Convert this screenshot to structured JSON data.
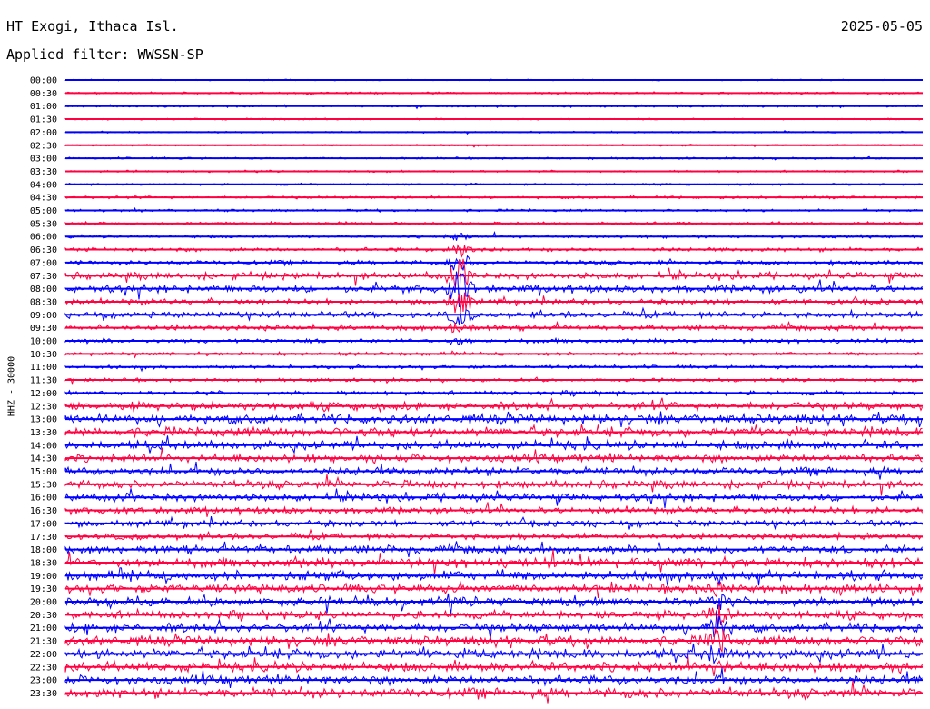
{
  "header": {
    "station": "HT Exogi, Ithaca Isl.",
    "date": "2025-05-05",
    "filter": "Applied filter: WWSSN-SP"
  },
  "colors": {
    "even_hour": "#0000ff",
    "odd_hour": "#ff0040",
    "background": "#ffffff"
  },
  "chart_data": {
    "type": "line",
    "title": "HT Exogi, Ithaca Isl.",
    "ylabel": "HHZ - 30000",
    "row_labels": [
      "00:00",
      "00:30",
      "01:00",
      "01:30",
      "02:00",
      "02:30",
      "03:00",
      "03:30",
      "04:00",
      "04:30",
      "05:00",
      "05:30",
      "06:00",
      "06:30",
      "07:00",
      "07:30",
      "08:00",
      "08:30",
      "09:00",
      "09:30",
      "10:00",
      "10:30",
      "11:00",
      "11:30",
      "12:00",
      "12:30",
      "13:00",
      "13:30",
      "14:00",
      "14:30",
      "15:00",
      "15:30",
      "16:00",
      "16:30",
      "17:00",
      "17:30",
      "18:00",
      "18:30",
      "19:00",
      "19:30",
      "20:00",
      "20:30",
      "21:00",
      "21:30",
      "22:00",
      "22:30",
      "23:00",
      "23:30"
    ],
    "row_colors": [
      "blue",
      "red",
      "blue",
      "red",
      "blue",
      "red",
      "blue",
      "red",
      "blue",
      "red",
      "blue",
      "red",
      "blue",
      "red",
      "blue",
      "red",
      "blue",
      "red",
      "blue",
      "red",
      "blue",
      "red",
      "blue",
      "red",
      "blue",
      "red",
      "blue",
      "red",
      "blue",
      "red",
      "blue",
      "red",
      "blue",
      "red",
      "blue",
      "red",
      "blue",
      "red",
      "blue",
      "red",
      "blue",
      "red",
      "blue",
      "red",
      "blue",
      "red",
      "blue",
      "red"
    ],
    "activity_level": [
      0.08,
      0.12,
      0.14,
      0.1,
      0.1,
      0.1,
      0.12,
      0.12,
      0.12,
      0.15,
      0.15,
      0.18,
      0.18,
      0.22,
      0.25,
      0.4,
      0.45,
      0.3,
      0.35,
      0.3,
      0.25,
      0.2,
      0.2,
      0.2,
      0.25,
      0.45,
      0.55,
      0.55,
      0.5,
      0.45,
      0.45,
      0.45,
      0.45,
      0.4,
      0.35,
      0.35,
      0.45,
      0.55,
      0.55,
      0.5,
      0.5,
      0.45,
      0.5,
      0.55,
      0.55,
      0.55,
      0.5,
      0.55
    ],
    "events": [
      {
        "row": 16,
        "time_fraction": 0.46,
        "amplitude": 3.0,
        "label": "large event near 08:00"
      },
      {
        "row": 42,
        "time_fraction": 0.76,
        "amplitude": 2.5,
        "label": "burst near 21:00"
      }
    ]
  }
}
